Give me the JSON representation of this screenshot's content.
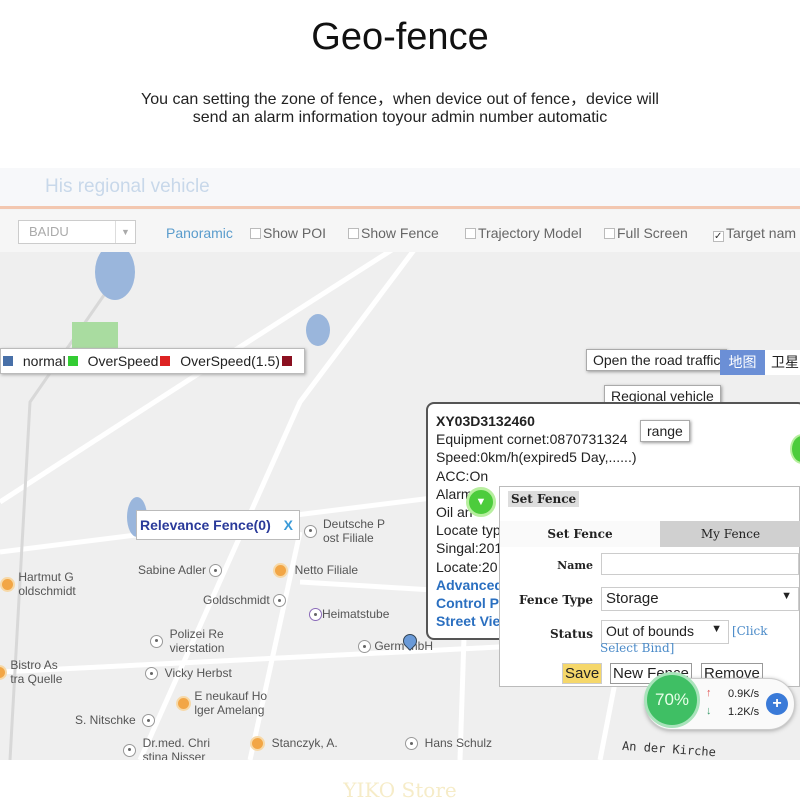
{
  "heading": {
    "title": "Geo-fence",
    "line1": "You can setting the zone of fence，when device out of fence，device will",
    "line2": "send an alarm information toyour admin number automatic"
  },
  "header": {
    "title": "His regional vehicle",
    "accent": "#f3c7b0"
  },
  "toolbar": {
    "map_select": "BAIDU",
    "panoramic": "Panoramic",
    "show_poi": "Show POI",
    "show_fence": "Show Fence",
    "trajectory": "Trajectory Model",
    "full_screen": "Full Screen",
    "target_name": "Target nam",
    "target_checked": true
  },
  "legend": [
    {
      "label": "normal",
      "color": "#33cc33"
    },
    {
      "label": "OverSpeed",
      "color": "#dd2222"
    },
    {
      "label": "OverSpeed(1.5)",
      "color": "#8b1020"
    }
  ],
  "map_buttons": {
    "traffic": "Open the road traffic",
    "map_tab": "地图",
    "satellite_tab": "卫星",
    "regional": "Regional vehicle",
    "range": "range",
    "relevance": "Relevance Fence(0)",
    "relevance_close": "X"
  },
  "pois": [
    "Deutsche P\nost Filiale",
    "Hartmut G\noldschmidt",
    "Sabine Adler",
    "Netto Filiale",
    "Goldschmidt",
    "Heimatstube",
    "Polizei Re\nvierstation",
    "Germ  mbH",
    "Bistro As\ntra Quelle",
    "Vicky Herbst",
    "E neukauf Ho\nlger Amelang",
    "S. Nitschke",
    "Dr.med. Chri\nstina Nisser",
    "Stanczyk, A.",
    "Hans Schulz",
    "An der Kirche"
  ],
  "info": {
    "id": "XY03D3132460",
    "equipment": "Equipment cornet:0870731324",
    "speed": "Speed:0km/h(expired5 Day,......)",
    "acc": "ACC:On",
    "alarm": "Alarm",
    "oil": "Oil an",
    "locate_type": "Locate typ",
    "signal": "Singal:201",
    "locate": "Locate:20",
    "advanced": "Advanced",
    "control": "Control Pa",
    "street": "Street Vie"
  },
  "fence": {
    "title": "Set Fence",
    "tab_set": "Set Fence",
    "tab_my": "My Fence",
    "name_label": "Name",
    "name_value": "",
    "type_label": "Fence Type",
    "type_value": "Storage",
    "status_label": "Status",
    "status_value": "Out of bounds",
    "click_bind": "[Click Select Bind]",
    "save": "Save",
    "new_fence": "New Fence",
    "remove": "Remove"
  },
  "network": {
    "percent": "70%",
    "up": "0.9K/s",
    "down": "1.2K/s"
  },
  "watermark": "YIKO Store"
}
